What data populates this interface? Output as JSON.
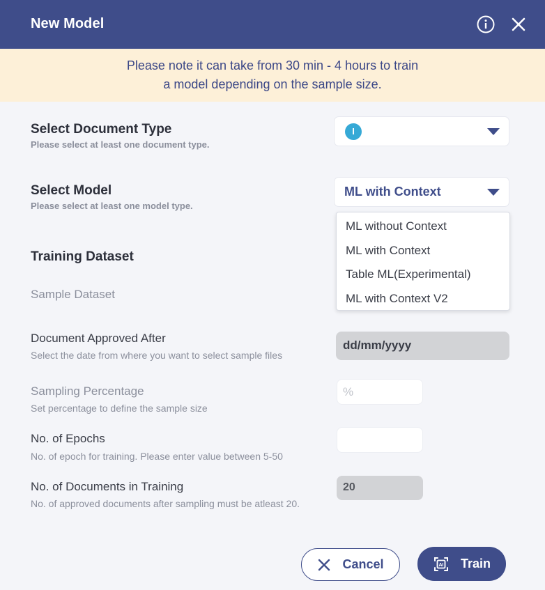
{
  "header": {
    "title": "New Model",
    "info_icon": "info-circle-icon",
    "close_icon": "close-x-icon"
  },
  "notice": {
    "text": "Please note it can take from 30 min - 4 hours to train a model depending on the sample size."
  },
  "document_type": {
    "label": "Select Document Type",
    "hint": "Please select at least one document type.",
    "badge": "I"
  },
  "model": {
    "label": "Select Model",
    "hint": "Please select at least one model type.",
    "selected": "ML with Context",
    "options": [
      "ML without Context",
      "ML with Context",
      "Table ML(Experimental)",
      "ML with Context V2"
    ]
  },
  "training": {
    "section_title": "Training Dataset",
    "sample_dataset_label": "Sample Dataset",
    "approved_after": {
      "label": "Document Approved After",
      "hint": "Select the date from where you want to select sample files",
      "placeholder": "dd/mm/yyyy"
    },
    "sampling_percentage": {
      "label": "Sampling Percentage",
      "hint": "Set percentage to define the sample size",
      "placeholder": "%"
    },
    "epochs": {
      "label": "No. of Epochs",
      "hint": "No. of epoch for training. Please enter value between 5-50",
      "value": ""
    },
    "documents": {
      "label": "No. of Documents in Training",
      "hint": "No. of approved documents after sampling must be atleast 20.",
      "value": "20"
    }
  },
  "actions": {
    "cancel_label": "Cancel",
    "train_label": "Train"
  },
  "colors": {
    "primary": "#3f4d8a",
    "notice_bg": "#fdf0d8",
    "badge": "#36a9d6",
    "background": "#f4f5f9"
  }
}
